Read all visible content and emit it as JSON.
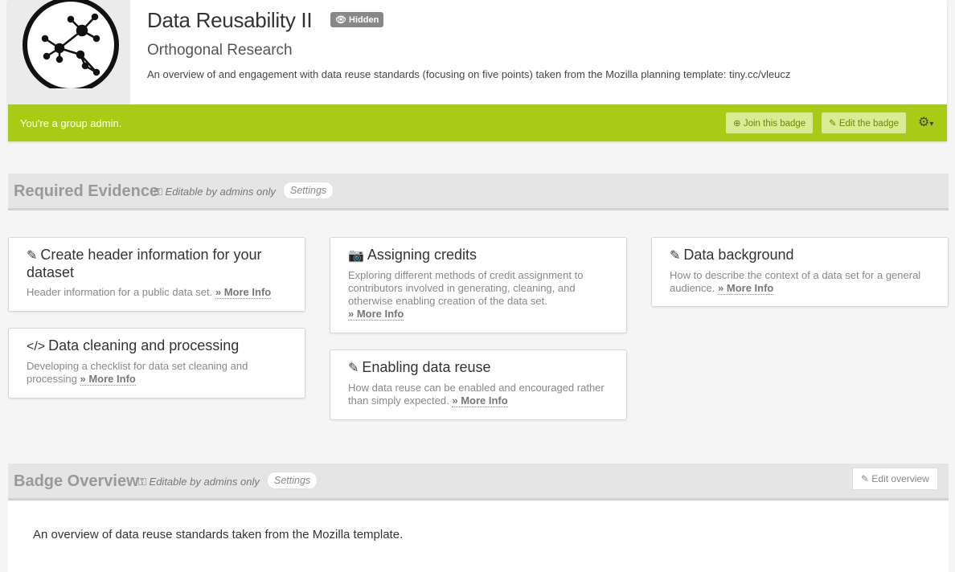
{
  "header": {
    "title": "Data Reusability II",
    "hidden_label": "Hidden",
    "org": "Orthogonal Research",
    "description": "An overview of and engagement with data reuse standards (focusing on five points) taken from the Mozilla planning template: tiny.cc/vleucz"
  },
  "admin_bar": {
    "text": "You're a group admin.",
    "join_label": "Join this badge",
    "edit_label": "Edit the badge",
    "color": "#a7cc18"
  },
  "required_evidence": {
    "title": "Required Evidence",
    "editable_note": "Editable by admins only",
    "settings_label": "Settings",
    "cards": [
      {
        "icon": "pencil-icon",
        "title": "Create header information for your dataset",
        "desc": "Header information for a public data set.",
        "more": "More Info"
      },
      {
        "icon": "code-icon",
        "title": "Data cleaning and processing",
        "desc": "Developing a checklist for data set cleaning and processing",
        "more": "More Info"
      },
      {
        "icon": "camera-icon",
        "title": "Assigning credits",
        "desc": "Exploring different methods of credit assignment to contributors involved in generating, cleaning, and otherwise enabling creation of the data set.",
        "more": "More Info"
      },
      {
        "icon": "pencil-icon",
        "title": "Enabling data reuse",
        "desc": "How data reuse can be enabled and encouraged rather than simply expected.",
        "more": "More Info"
      },
      {
        "icon": "pencil-icon",
        "title": "Data background",
        "desc": "How to describe the context of a data set for a general audience.",
        "more": "More Info"
      }
    ]
  },
  "badge_overview": {
    "title": "Badge Overview",
    "editable_note": "Editable by admins only",
    "settings_label": "Settings",
    "edit_label": "Edit overview",
    "text": "An overview of data reuse standards taken from the Mozilla template."
  }
}
